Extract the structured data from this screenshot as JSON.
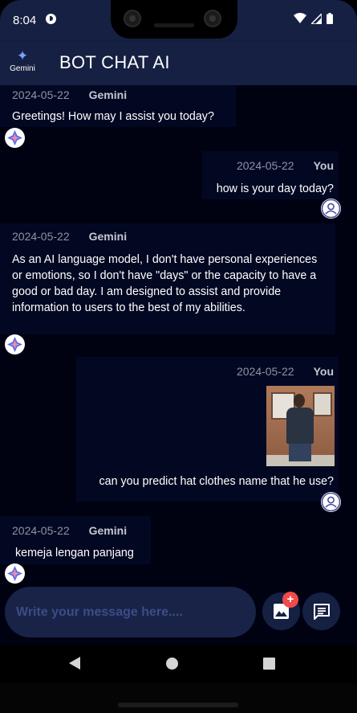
{
  "status_bar": {
    "time": "8:04",
    "icons": [
      "notification-icon",
      "wifi-icon",
      "signal-icon",
      "battery-icon"
    ]
  },
  "app_bar": {
    "logo_label": "Gemini",
    "logo_icon": "sparkle-icon",
    "title": "BOT CHAT AI"
  },
  "messages": [
    {
      "sender": "Gemini",
      "date": "2024-05-22",
      "text": "Greetings! How may I assist you today?",
      "avatar": "gemini-avatar-icon"
    },
    {
      "sender": "You",
      "date": "2024-05-22",
      "text": "how is your day today?",
      "avatar": "user-avatar-icon"
    },
    {
      "sender": "Gemini",
      "date": "2024-05-22",
      "text": "As an AI language model, I don't have personal experiences or emotions, so I don't have \"days\" or the capacity to have a good or bad day. I am designed to assist and provide information to users to the best of my abilities.",
      "avatar": "gemini-avatar-icon"
    },
    {
      "sender": "You",
      "date": "2024-05-22",
      "text": "can you predict hat clothes name that he use?",
      "has_image": true,
      "avatar": "user-avatar-icon"
    },
    {
      "sender": "Gemini",
      "date": "2024-05-22",
      "text": " kemeja lengan panjang",
      "avatar": "gemini-avatar-icon"
    }
  ],
  "composer": {
    "placeholder": "Write your message here....",
    "image_button_icon": "image-icon",
    "image_badge": "+",
    "send_button_icon": "chat-icon"
  },
  "nav_bar": {
    "icons": [
      "back-icon",
      "home-icon",
      "recents-icon"
    ]
  },
  "colors": {
    "app_bar": "#152042",
    "chat_background": "#000212",
    "bubble": "#030822",
    "input": "#182347",
    "placeholder": "#3d4c88",
    "badge": "#f04a4a"
  }
}
